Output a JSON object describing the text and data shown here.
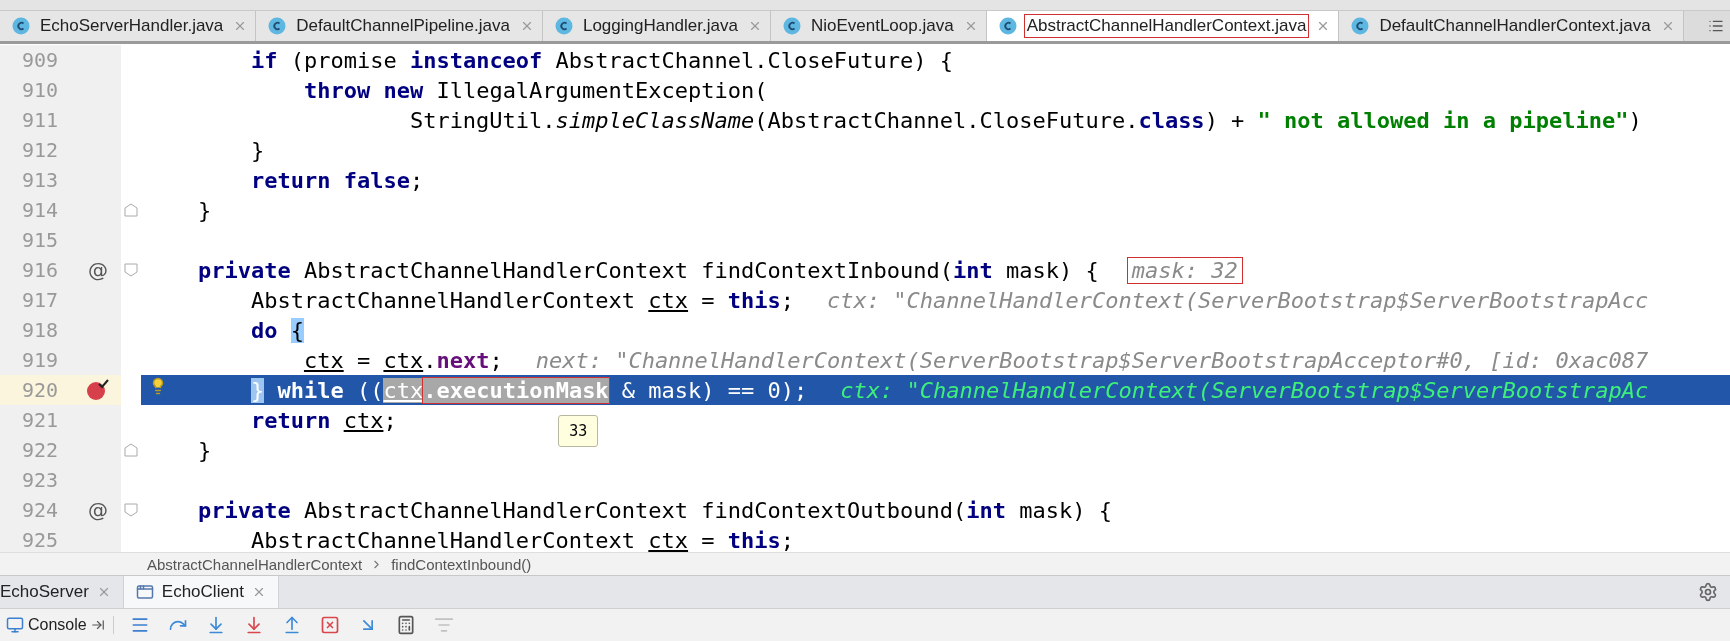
{
  "tabs": [
    {
      "label": "EchoServerHandler.java",
      "selected": false,
      "annotated": false
    },
    {
      "label": "DefaultChannelPipeline.java",
      "selected": false,
      "annotated": false
    },
    {
      "label": "LoggingHandler.java",
      "selected": false,
      "annotated": false
    },
    {
      "label": "NioEventLoop.java",
      "selected": false,
      "annotated": false
    },
    {
      "label": "AbstractChannelHandlerContext.java",
      "selected": true,
      "annotated": true
    },
    {
      "label": "DefaultChannelHandlerContext.java",
      "selected": false,
      "annotated": false
    }
  ],
  "editor": {
    "lines": [
      {
        "number": "909",
        "kind": "body",
        "current": false,
        "tokens": [
          {
            "kind": "keyword",
            "text": "if"
          },
          {
            "kind": "plain",
            "text": " (promise "
          },
          {
            "kind": "keyword",
            "text": "instanceof"
          },
          {
            "kind": "plain",
            "text": " AbstractChannel.CloseFuture) {"
          }
        ]
      },
      {
        "number": "910",
        "kind": "nested",
        "current": false,
        "tokens": [
          {
            "kind": "keyword",
            "text": "throw new"
          },
          {
            "kind": "plain",
            "text": " IllegalArgumentException("
          }
        ]
      },
      {
        "number": "911",
        "kind": "continuation",
        "current": false,
        "tokens": [
          {
            "kind": "plain",
            "text": "StringUtil."
          },
          {
            "kind": "italic",
            "text": "simpleClassName"
          },
          {
            "kind": "plain",
            "text": "(AbstractChannel.CloseFuture."
          },
          {
            "kind": "keyword",
            "text": "class"
          },
          {
            "kind": "plain",
            "text": ") + "
          },
          {
            "kind": "string",
            "text": "\" not allowed in a pipeline\""
          },
          {
            "kind": "plain",
            "text": ")"
          }
        ]
      },
      {
        "number": "912",
        "kind": "body",
        "current": false,
        "tokens": [
          {
            "kind": "plain",
            "text": "}"
          }
        ]
      },
      {
        "number": "913",
        "kind": "body",
        "current": false,
        "tokens": [
          {
            "kind": "keyword",
            "text": "return false"
          },
          {
            "kind": "plain",
            "text": ";"
          }
        ]
      },
      {
        "number": "914",
        "kind": "member",
        "current": false,
        "fold_end": true,
        "tokens": [
          {
            "kind": "plain",
            "text": "}"
          }
        ]
      },
      {
        "number": "915",
        "current": false
      },
      {
        "number": "916",
        "kind": "member",
        "current": false,
        "override_mark": "@",
        "fold_start": true,
        "tokens": [
          {
            "kind": "keyword",
            "text": "private"
          },
          {
            "kind": "plain",
            "text": " AbstractChannelHandlerContext findContextInbound("
          },
          {
            "kind": "keyword",
            "text": "int"
          },
          {
            "kind": "plain",
            "text": " mask) {"
          }
        ],
        "hint": {
          "text": "mask: 32",
          "annotated": true
        }
      },
      {
        "number": "917",
        "kind": "body",
        "current": false,
        "tokens": [
          {
            "kind": "plain",
            "text": "AbstractChannelHandlerContext "
          },
          {
            "kind": "var",
            "text": "ctx"
          },
          {
            "kind": "plain",
            "text": " = "
          },
          {
            "kind": "keyword",
            "text": "this"
          },
          {
            "kind": "plain",
            "text": ";"
          }
        ],
        "hint": {
          "text": "ctx: \"ChannelHandlerContext(ServerBootstrap$ServerBootstrapAcc",
          "annotated": false
        }
      },
      {
        "number": "918",
        "kind": "body",
        "current": false,
        "tokens": [
          {
            "kind": "keyword",
            "text": "do "
          },
          {
            "kind": "brace",
            "text": "{"
          }
        ]
      },
      {
        "number": "919",
        "kind": "nested",
        "current": false,
        "tokens": [
          {
            "kind": "var",
            "text": "ctx"
          },
          {
            "kind": "plain",
            "text": " = "
          },
          {
            "kind": "var",
            "text": "ctx"
          },
          {
            "kind": "plain",
            "text": "."
          },
          {
            "kind": "field",
            "text": "next"
          },
          {
            "kind": "plain",
            "text": ";"
          }
        ],
        "hint": {
          "text": "next: \"ChannelHandlerContext(ServerBootstrap$ServerBootstrapAcceptor#0, [id: 0xac087",
          "annotated": false
        }
      },
      {
        "number": "920",
        "kind": "body",
        "current": true,
        "breakpoint": true,
        "bulb": true,
        "tokens": [
          {
            "kind": "brace",
            "text": "}"
          },
          {
            "kind": "keyword",
            "text": " while"
          },
          {
            "kind": "plain",
            "text": " (("
          },
          {
            "kind": "selected_var",
            "text": "ctx"
          },
          {
            "kind": "selected_field",
            "text": ".executionMask",
            "annotated": true,
            "tooltip": "33"
          },
          {
            "kind": "plain",
            "text": " & mask) == 0);"
          }
        ],
        "hint": {
          "text": "ctx: \"ChannelHandlerContext(ServerBootstrap$ServerBootstrapAc",
          "annotated": false
        }
      },
      {
        "number": "921",
        "kind": "body",
        "current": false,
        "tokens": [
          {
            "kind": "keyword",
            "text": "return "
          },
          {
            "kind": "var",
            "text": "ctx"
          },
          {
            "kind": "plain",
            "text": ";"
          }
        ]
      },
      {
        "number": "922",
        "kind": "member",
        "current": false,
        "fold_end": true,
        "tokens": [
          {
            "kind": "plain",
            "text": "}"
          }
        ]
      },
      {
        "number": "923",
        "current": false
      },
      {
        "number": "924",
        "kind": "member",
        "current": false,
        "override_mark": "@",
        "fold_start": true,
        "tokens": [
          {
            "kind": "keyword",
            "text": "private"
          },
          {
            "kind": "plain",
            "text": " AbstractChannelHandlerContext findContextOutbound("
          },
          {
            "kind": "keyword",
            "text": "int"
          },
          {
            "kind": "plain",
            "text": " mask) {"
          }
        ]
      },
      {
        "number": "925",
        "kind": "body",
        "current": false,
        "tokens": [
          {
            "kind": "plain",
            "text": "AbstractChannelHandlerContext "
          },
          {
            "kind": "var",
            "text": "ctx"
          },
          {
            "kind": "plain",
            "text": " = "
          },
          {
            "kind": "keyword",
            "text": "this"
          },
          {
            "kind": "plain",
            "text": ";"
          }
        ]
      }
    ]
  },
  "breadcrumb": [
    "AbstractChannelHandlerContext",
    "findContextInbound()"
  ],
  "run_tabs": [
    {
      "label": "EchoServer",
      "selected": false
    },
    {
      "label": "EchoClient",
      "selected": true
    }
  ],
  "debug_toolbar": {
    "console_label": "Console",
    "buttons": [
      {
        "kind": "menu",
        "disabled": false
      },
      {
        "kind": "step_over",
        "disabled": false
      },
      {
        "kind": "step_into",
        "disabled": false
      },
      {
        "kind": "force_step_into",
        "disabled": false
      },
      {
        "kind": "step_out",
        "disabled": false
      },
      {
        "kind": "drop_frame",
        "disabled": false
      },
      {
        "kind": "run_to_cursor",
        "disabled": false
      },
      {
        "kind": "evaluate",
        "disabled": false
      },
      {
        "kind": "trace",
        "disabled": true
      }
    ]
  }
}
